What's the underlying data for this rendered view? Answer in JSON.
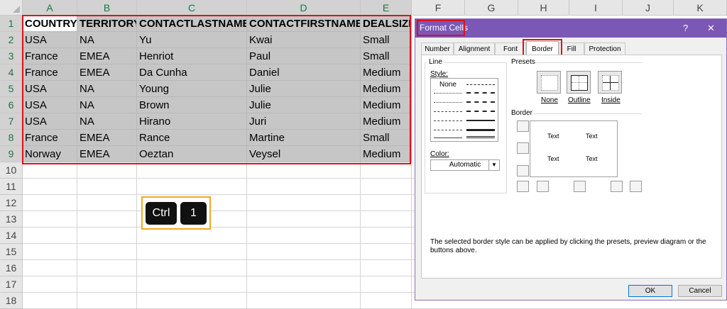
{
  "columns": [
    "A",
    "B",
    "C",
    "D",
    "E",
    "F",
    "G",
    "H",
    "I",
    "J",
    "K"
  ],
  "rows": [
    "1",
    "2",
    "3",
    "4",
    "5",
    "6",
    "7",
    "8",
    "9",
    "10",
    "11",
    "12",
    "13",
    "14",
    "15",
    "16",
    "17",
    "18"
  ],
  "table": {
    "headers": [
      "COUNTRY",
      "TERRITORY",
      "CONTACTLASTNAME",
      "CONTACTFIRSTNAME",
      "DEALSIZE"
    ],
    "records": [
      [
        "USA",
        "NA",
        "Yu",
        "Kwai",
        "Small"
      ],
      [
        "France",
        "EMEA",
        "Henriot",
        "Paul",
        "Small"
      ],
      [
        "France",
        "EMEA",
        "Da Cunha",
        "Daniel",
        "Medium"
      ],
      [
        "USA",
        "NA",
        "Young",
        "Julie",
        "Medium"
      ],
      [
        "USA",
        "NA",
        "Brown",
        "Julie",
        "Medium"
      ],
      [
        "USA",
        "NA",
        "Hirano",
        "Juri",
        "Medium"
      ],
      [
        "France",
        "EMEA",
        "Rance",
        "Martine",
        "Small"
      ],
      [
        "Norway",
        "EMEA",
        "Oeztan",
        "Veysel",
        "Medium"
      ]
    ]
  },
  "shortcut": {
    "key1": "Ctrl",
    "key2": "1"
  },
  "dialog": {
    "title": "Format Cells",
    "help": "?",
    "close": "✕",
    "tabs": [
      "Number",
      "Alignment",
      "Font",
      "Border",
      "Fill",
      "Protection"
    ],
    "active_tab": "Border",
    "line_group": "Line",
    "style_label": "Style:",
    "style_none": "None",
    "color_label": "Color:",
    "color_value": "Automatic",
    "presets_label": "Presets",
    "presets": [
      "None",
      "Outline",
      "Inside"
    ],
    "border_label": "Border",
    "preview_texts": [
      "Text",
      "Text",
      "Text",
      "Text"
    ],
    "note": "The selected border style can be applied by clicking the presets, preview diagram or the buttons above.",
    "ok": "OK",
    "cancel": "Cancel"
  },
  "colors": {
    "accent": "#7b57b6",
    "highlight": "#e0101a",
    "key_frame": "#f0a820",
    "selection": "#c6c6c6",
    "excel_green": "#217346"
  }
}
